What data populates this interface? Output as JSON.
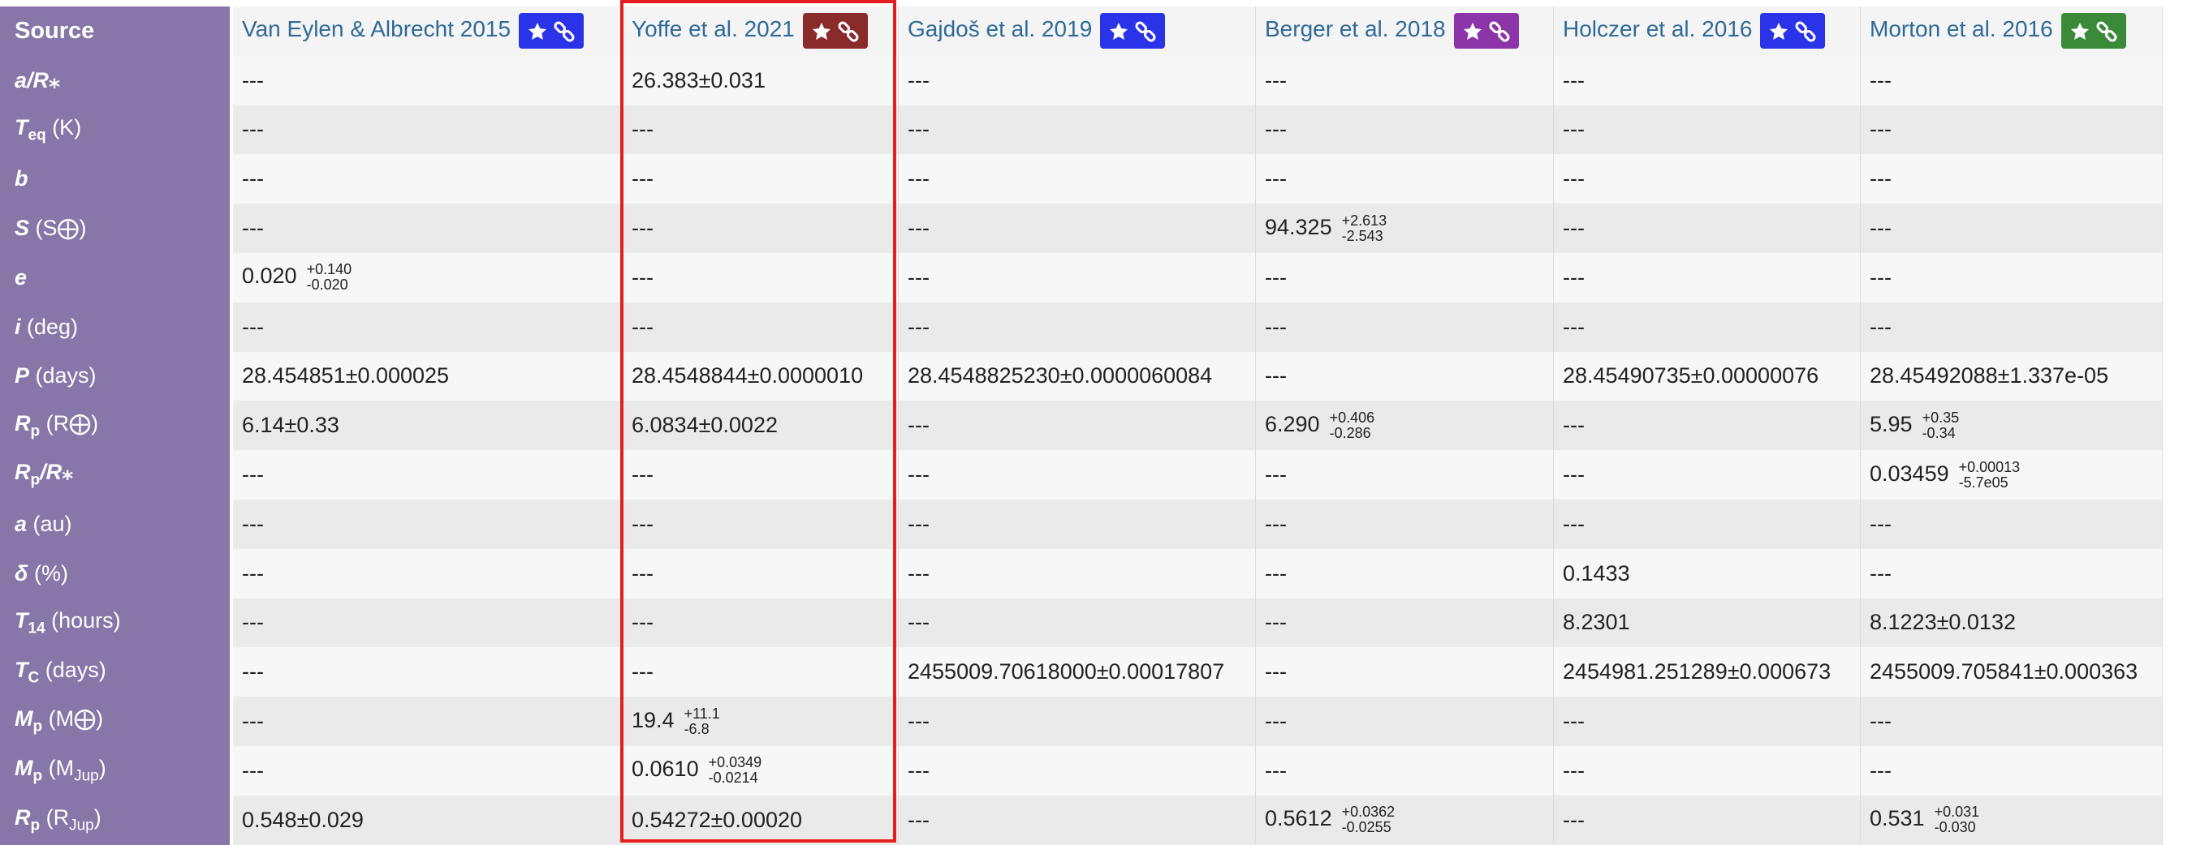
{
  "corner_label": "Source",
  "sources": [
    {
      "name": "Van Eylen & Albrecht 2015",
      "badge_color": "#2a33e8"
    },
    {
      "name": "Yoffe et al. 2021",
      "badge_color": "#8a2b2b"
    },
    {
      "name": "Gajdoš et al. 2019",
      "badge_color": "#2a33e8"
    },
    {
      "name": "Berger et al. 2018",
      "badge_color": "#8c35a8"
    },
    {
      "name": "Holczer et al. 2016",
      "badge_color": "#2a33e8"
    },
    {
      "name": "Morton et al. 2016",
      "badge_color": "#3a8a3a"
    }
  ],
  "badge_icons": [
    "star-icon",
    "link-icon"
  ],
  "rows": [
    {
      "sym": "a/R",
      "sub": "",
      "star": "⁎",
      "unit": "",
      "cells": [
        {
          "v": "---"
        },
        {
          "v": "26.383±0.031"
        },
        {
          "v": "---"
        },
        {
          "v": "---"
        },
        {
          "v": "---"
        },
        {
          "v": "---"
        }
      ]
    },
    {
      "sym": "T",
      "sub": "eq",
      "star": "",
      "unit": " (K)",
      "cells": [
        {
          "v": "---"
        },
        {
          "v": "---"
        },
        {
          "v": "---"
        },
        {
          "v": "---"
        },
        {
          "v": "---"
        },
        {
          "v": "---"
        }
      ]
    },
    {
      "sym": "b",
      "sub": "",
      "star": "",
      "unit": "",
      "cells": [
        {
          "v": "---"
        },
        {
          "v": "---"
        },
        {
          "v": "---"
        },
        {
          "v": "---"
        },
        {
          "v": "---"
        },
        {
          "v": "---"
        }
      ]
    },
    {
      "sym": "S",
      "sub": "",
      "star": "",
      "unit": " (S⨁)",
      "cells": [
        {
          "v": "---"
        },
        {
          "v": "---"
        },
        {
          "v": "---"
        },
        {
          "v": "94.325",
          "up": "+2.613",
          "lo": "-2.543"
        },
        {
          "v": "---"
        },
        {
          "v": "---"
        }
      ]
    },
    {
      "sym": "e",
      "sub": "",
      "star": "",
      "unit": "",
      "cells": [
        {
          "v": "0.020",
          "up": "+0.140",
          "lo": "-0.020"
        },
        {
          "v": "---"
        },
        {
          "v": "---"
        },
        {
          "v": "---"
        },
        {
          "v": "---"
        },
        {
          "v": "---"
        }
      ]
    },
    {
      "sym": "i",
      "sub": "",
      "star": "",
      "unit": " (deg)",
      "cells": [
        {
          "v": "---"
        },
        {
          "v": "---"
        },
        {
          "v": "---"
        },
        {
          "v": "---"
        },
        {
          "v": "---"
        },
        {
          "v": "---"
        }
      ]
    },
    {
      "sym": "P",
      "sub": "",
      "star": "",
      "unit": " (days)",
      "cells": [
        {
          "v": "28.454851±0.000025"
        },
        {
          "v": "28.4548844±0.0000010"
        },
        {
          "v": "28.4548825230±0.0000060084"
        },
        {
          "v": "---"
        },
        {
          "v": "28.45490735±0.00000076"
        },
        {
          "v": "28.45492088±1.337e-05"
        }
      ]
    },
    {
      "sym": "R",
      "sub": "p",
      "star": "",
      "unit": " (R⨁)",
      "cells": [
        {
          "v": "6.14±0.33"
        },
        {
          "v": "6.0834±0.0022"
        },
        {
          "v": "---"
        },
        {
          "v": "6.290",
          "up": "+0.406",
          "lo": "-0.286"
        },
        {
          "v": "---"
        },
        {
          "v": "5.95",
          "up": "+0.35",
          "lo": "-0.34"
        }
      ]
    },
    {
      "sym": "R",
      "sub": "p",
      "star": "",
      "unit": "",
      "tail": "/R⁎",
      "cells": [
        {
          "v": "---"
        },
        {
          "v": "---"
        },
        {
          "v": "---"
        },
        {
          "v": "---"
        },
        {
          "v": "---"
        },
        {
          "v": "0.03459",
          "up": "+0.00013",
          "lo": "-5.7e05"
        }
      ]
    },
    {
      "sym": "a",
      "sub": "",
      "star": "",
      "unit": " (au)",
      "cells": [
        {
          "v": "---"
        },
        {
          "v": "---"
        },
        {
          "v": "---"
        },
        {
          "v": "---"
        },
        {
          "v": "---"
        },
        {
          "v": "---"
        }
      ]
    },
    {
      "sym": "δ",
      "sub": "",
      "star": "",
      "unit": " (%)",
      "cells": [
        {
          "v": "---"
        },
        {
          "v": "---"
        },
        {
          "v": "---"
        },
        {
          "v": "---"
        },
        {
          "v": "0.1433"
        },
        {
          "v": "---"
        }
      ]
    },
    {
      "sym": "T",
      "sub": "14",
      "star": "",
      "unit": " (hours)",
      "cells": [
        {
          "v": "---"
        },
        {
          "v": "---"
        },
        {
          "v": "---"
        },
        {
          "v": "---"
        },
        {
          "v": "8.2301"
        },
        {
          "v": "8.1223±0.0132"
        }
      ]
    },
    {
      "sym": "T",
      "sub": "C",
      "star": "",
      "unit": " (days)",
      "cells": [
        {
          "v": "---"
        },
        {
          "v": "---"
        },
        {
          "v": "2455009.70618000±0.00017807"
        },
        {
          "v": "---"
        },
        {
          "v": "2454981.251289±0.000673"
        },
        {
          "v": "2455009.705841±0.000363"
        }
      ]
    },
    {
      "sym": "M",
      "sub": "p",
      "star": "",
      "unit": " (M⨁)",
      "cells": [
        {
          "v": "---"
        },
        {
          "v": "19.4",
          "up": "+11.1",
          "lo": "-6.8"
        },
        {
          "v": "---"
        },
        {
          "v": "---"
        },
        {
          "v": "---"
        },
        {
          "v": "---"
        }
      ]
    },
    {
      "sym": "M",
      "sub": "p",
      "star": "",
      "unit": " (M",
      "unit_sub": "Jup",
      "unit_end": ")",
      "cells": [
        {
          "v": "---"
        },
        {
          "v": "0.0610",
          "up": "+0.0349",
          "lo": "-0.0214"
        },
        {
          "v": "---"
        },
        {
          "v": "---"
        },
        {
          "v": "---"
        },
        {
          "v": "---"
        }
      ]
    },
    {
      "sym": "R",
      "sub": "p",
      "star": "",
      "unit": " (R",
      "unit_sub": "Jup",
      "unit_end": ")",
      "cells": [
        {
          "v": "0.548±0.029"
        },
        {
          "v": "0.54272±0.00020"
        },
        {
          "v": "---"
        },
        {
          "v": "0.5612",
          "up": "+0.0362",
          "lo": "-0.0255"
        },
        {
          "v": "---"
        },
        {
          "v": "0.531",
          "up": "+0.031",
          "lo": "-0.030"
        }
      ]
    }
  ],
  "highlighted_source": "Yoffe et al. 2021"
}
